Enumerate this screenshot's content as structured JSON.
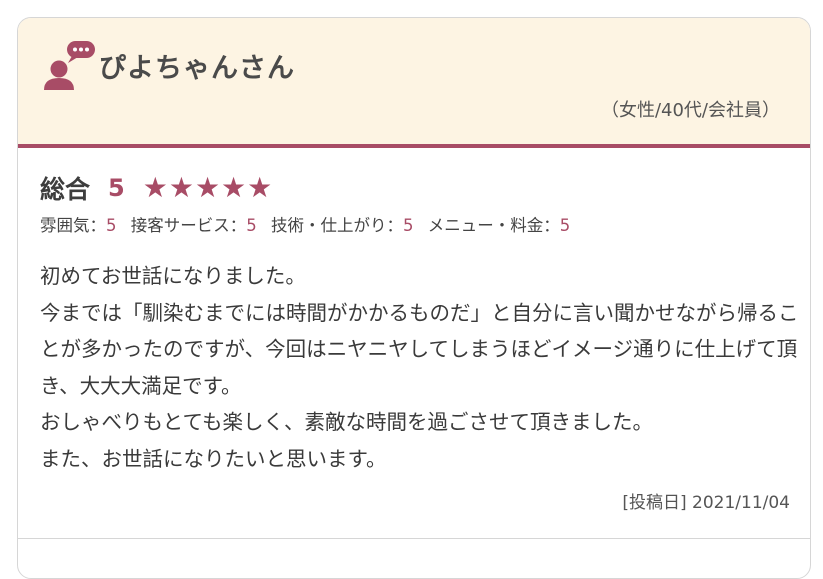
{
  "reviewer": {
    "name": "ぴよちゃんさん",
    "meta": "（女性/40代/会社員）",
    "avatar_icon": "user-comment-icon"
  },
  "rating": {
    "overall_label": "総合",
    "overall_score": "5",
    "stars": 5,
    "star_color": "#a84c66",
    "sub_ratings": [
      {
        "label": "雰囲気：",
        "value": "5"
      },
      {
        "label": "接客サービス：",
        "value": "5"
      },
      {
        "label": "技術・仕上がり：",
        "value": "5"
      },
      {
        "label": "メニュー・料金：",
        "value": "5"
      }
    ]
  },
  "review": {
    "text": "初めてお世話になりました。\n今までは「馴染むまでには時間がかかるものだ」と自分に言い聞かせながら帰ることが多かったのですが、今回はニヤニヤしてしまうほどイメージ通りに仕上げて頂き、大大大満足です。\nおしゃべりもとても楽しく、素敵な時間を過ごさせて頂きました。\nまた、お世話になりたいと思います。",
    "post_date": "[投稿日] 2021/11/04"
  },
  "colors": {
    "accent": "#a84c66",
    "header_bg": "#fdf4e3"
  }
}
